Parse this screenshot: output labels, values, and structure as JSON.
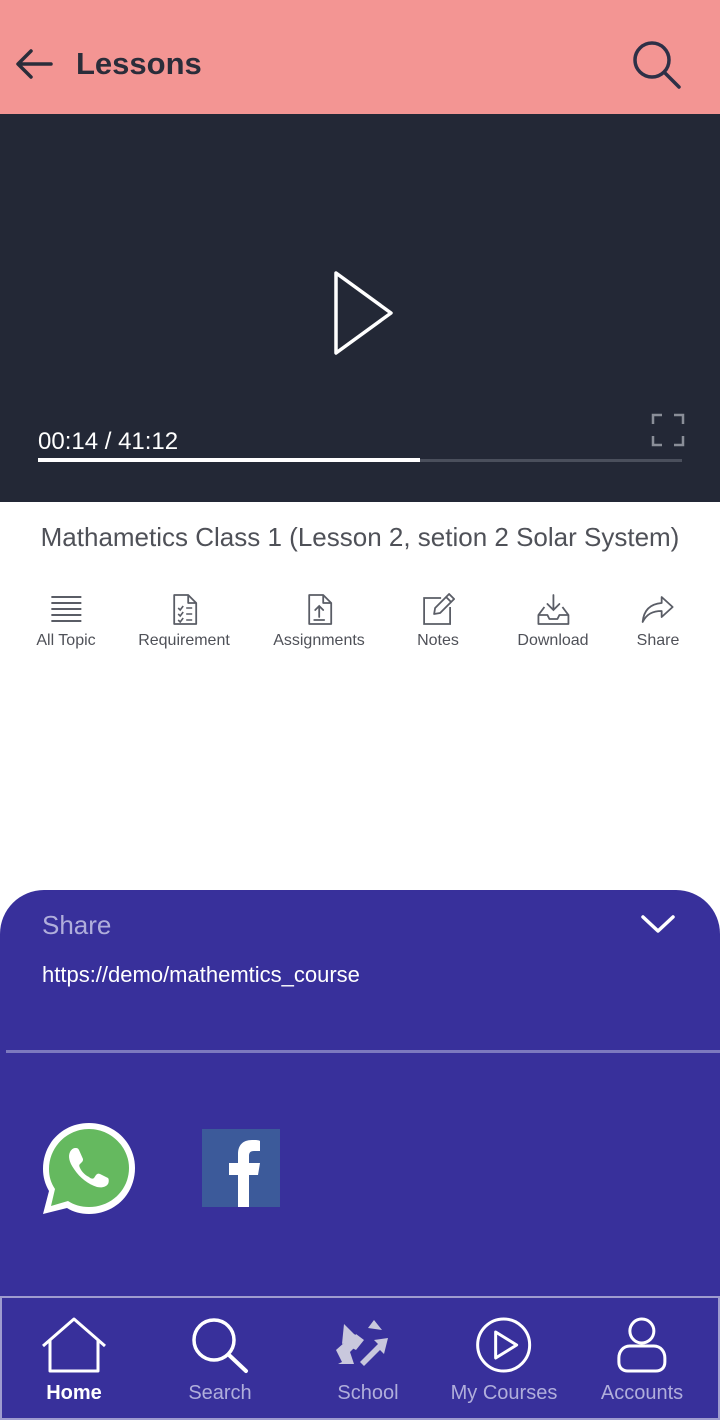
{
  "header": {
    "title": "Lessons",
    "back_icon": "arrow-left-icon",
    "search_icon": "search-icon",
    "background": "#f39593"
  },
  "player": {
    "time_readout": "00:14 / 41:12",
    "progress_fraction": 0.593,
    "play_icon": "play-icon",
    "fullscreen_icon": "fullscreen-icon",
    "background": "#232836"
  },
  "lesson": {
    "title": "Mathametics Class 1 (Lesson 2, setion 2  Solar System)"
  },
  "actions": [
    {
      "label": "All Topic",
      "icon": "list-icon"
    },
    {
      "label": "Requirement",
      "icon": "checklist-document-icon"
    },
    {
      "label": "Assignments",
      "icon": "upload-document-icon"
    },
    {
      "label": "Notes",
      "icon": "pencil-edit-icon"
    },
    {
      "label": "Download",
      "icon": "download-tray-icon"
    },
    {
      "label": "Share",
      "icon": "share-arrow-icon"
    }
  ],
  "share_sheet": {
    "title": "Share",
    "url": "https://demo/mathemtics_course",
    "collapse_icon": "chevron-down-icon",
    "targets": [
      {
        "icon": "whatsapp-icon",
        "color": "#65b95f"
      },
      {
        "icon": "facebook-icon",
        "color": "#3c5a9a"
      }
    ],
    "background": "#38309b"
  },
  "bottom_nav": {
    "items": [
      {
        "label": "Home",
        "icon": "home-icon",
        "active": true
      },
      {
        "label": "Search",
        "icon": "search-icon",
        "active": false
      },
      {
        "label": "School",
        "icon": "school-arrows-icon",
        "active": false
      },
      {
        "label": "My Courses",
        "icon": "play-circle-icon",
        "active": false
      },
      {
        "label": "Accounts",
        "icon": "user-icon",
        "active": false
      }
    ]
  }
}
